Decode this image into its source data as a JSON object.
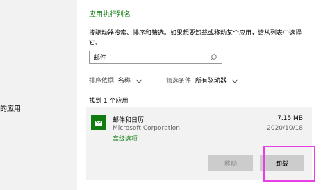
{
  "sidebar": {
    "partial_label": "的应用"
  },
  "section": {
    "title": "应用执行别名",
    "description": "按驱动器搜索、排序和筛选。如果想要卸载或移动某个应用，请从列表中选择它。"
  },
  "search": {
    "value": "邮件",
    "icon": "search-icon"
  },
  "filters": {
    "sort_label": "排序依据:",
    "sort_value": "名称",
    "filter_label": "筛选条件:",
    "filter_value": "所有驱动器"
  },
  "results": {
    "found_text": "找到 1 个应用"
  },
  "app": {
    "name": "邮件和日历",
    "publisher": "Microsoft Corporation",
    "advanced_link": "高级选项",
    "size": "7.15 MB",
    "date": "2020/10/18",
    "move_label": "移动",
    "uninstall_label": "卸载",
    "accent_color": "#107c10"
  },
  "highlight_color": "#e83ee8"
}
